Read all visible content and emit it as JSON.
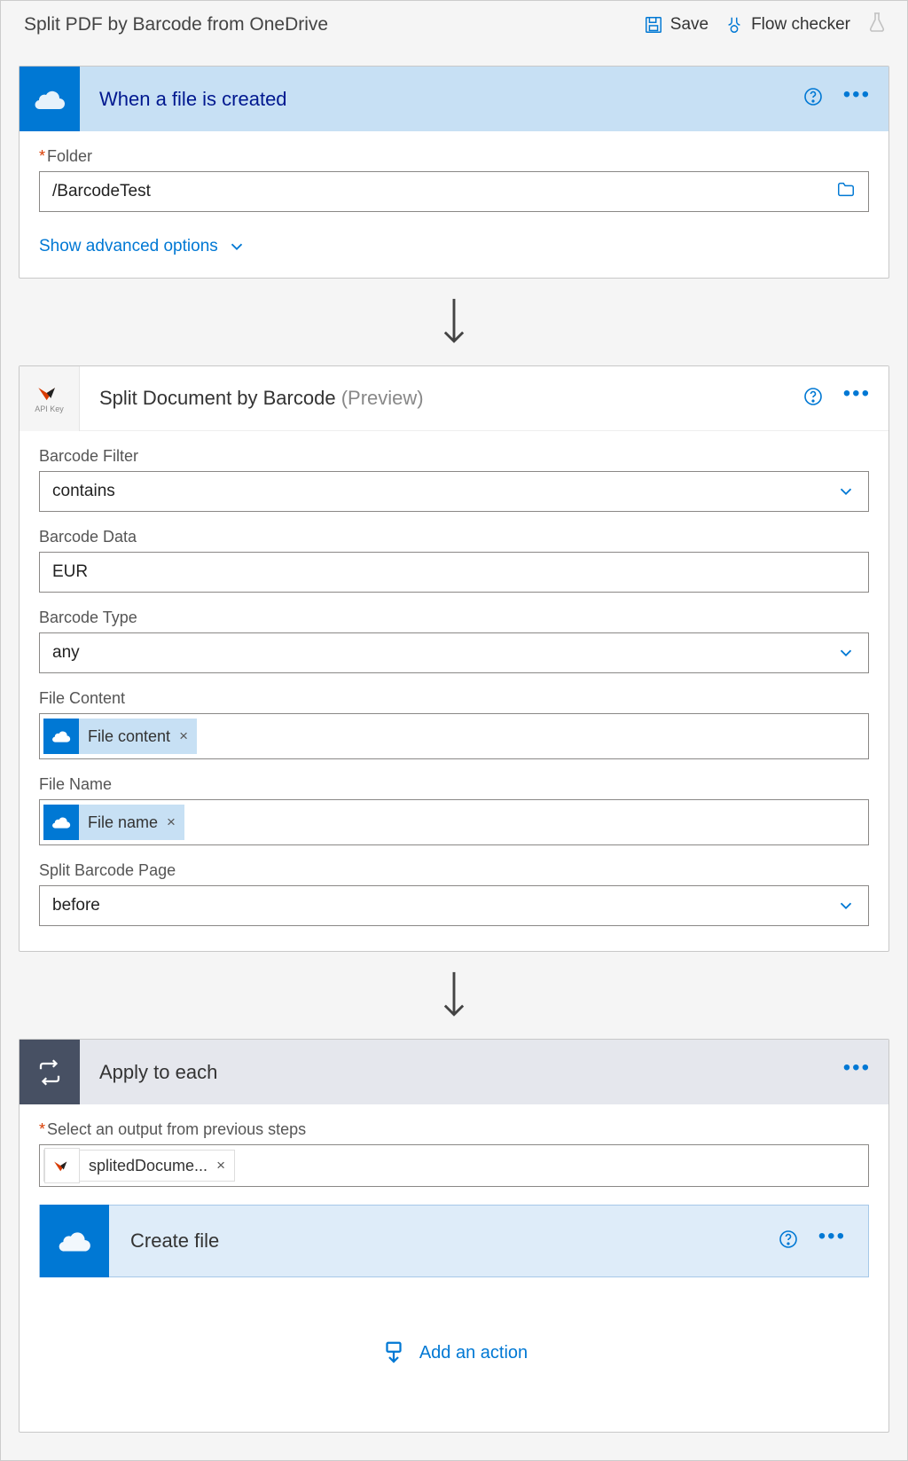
{
  "header": {
    "title": "Split PDF by Barcode from OneDrive",
    "save": "Save",
    "flow_checker": "Flow checker"
  },
  "step1": {
    "title": "When a file is created",
    "folder_label": "Folder",
    "folder_value": "/BarcodeTest",
    "advanced": "Show advanced options"
  },
  "step2": {
    "title": "Split Document by Barcode",
    "preview": "(Preview)",
    "fields": {
      "barcode_filter_label": "Barcode Filter",
      "barcode_filter_value": "contains",
      "barcode_data_label": "Barcode Data",
      "barcode_data_value": "EUR",
      "barcode_type_label": "Barcode Type",
      "barcode_type_value": "any",
      "file_content_label": "File Content",
      "file_content_token": "File content",
      "file_name_label": "File Name",
      "file_name_token": "File name",
      "split_page_label": "Split Barcode Page",
      "split_page_value": "before"
    }
  },
  "step3": {
    "title": "Apply to each",
    "select_label": "Select an output from previous steps",
    "select_token": "splitedDocume...",
    "inner_title": "Create file",
    "add_action": "Add an action"
  }
}
